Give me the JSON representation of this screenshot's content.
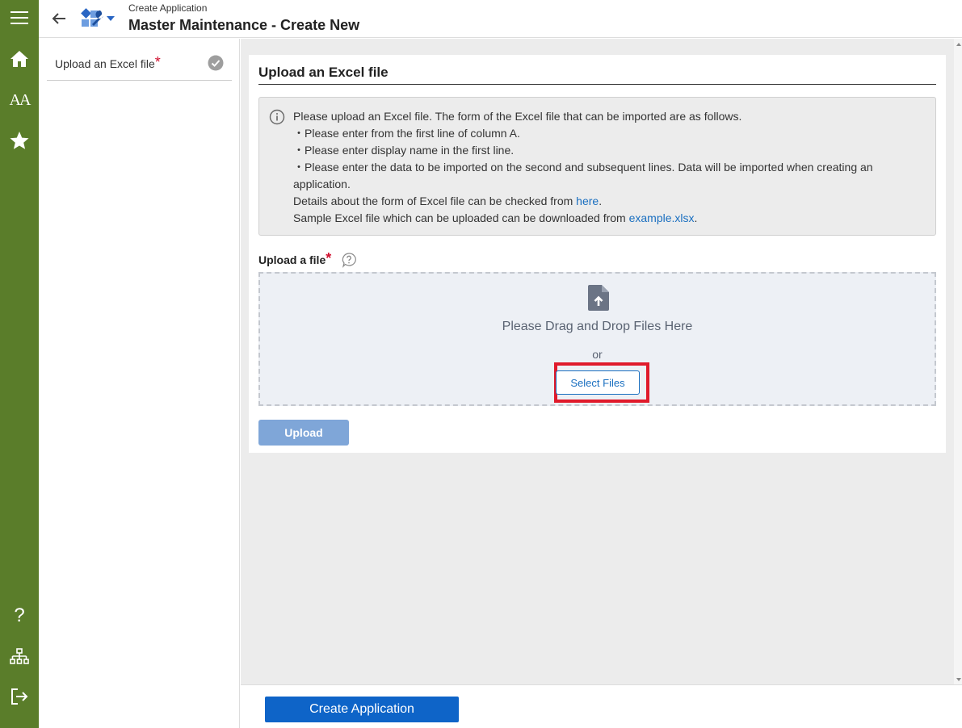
{
  "header": {
    "subtitle": "Create Application",
    "title": "Master Maintenance - Create New"
  },
  "rail": {
    "icons": [
      "menu-icon",
      "home-icon",
      "font-size-icon",
      "star-icon",
      "help-icon",
      "sitemap-icon",
      "logout-icon"
    ],
    "letters_label": "AA",
    "help_glyph": "?"
  },
  "steps": {
    "items": [
      {
        "label": "Upload an Excel file",
        "required_mark": "*"
      }
    ]
  },
  "section": {
    "title": "Upload an Excel file"
  },
  "info": {
    "line1": "Please upload an Excel file. The form of the Excel file that can be imported are as follows.",
    "line2": "・Please enter from the first line of column A.",
    "line3": "・Please enter display name in the first line.",
    "line4": "・Please enter the data to be imported on the second and subsequent lines. Data will be imported when creating an application.",
    "line5_prefix": "Details about the form of Excel file can be checked from ",
    "line5_link": "here",
    "line5_suffix": ".",
    "line6_prefix": "Sample Excel file which can be uploaded can be downloaded from ",
    "line6_link": "example.xlsx",
    "line6_suffix": "."
  },
  "upload": {
    "label": "Upload a file",
    "required_mark": "*",
    "drop_text": "Please Drag and Drop Files Here",
    "or_text": "or",
    "select_button": "Select Files",
    "upload_button": "Upload"
  },
  "footer": {
    "create_button": "Create Application"
  },
  "colors": {
    "rail": "#5a7d2a",
    "accent": "#0e64c8",
    "link": "#1a6fc0",
    "required": "#d0102f",
    "highlight": "#e01a2b"
  }
}
